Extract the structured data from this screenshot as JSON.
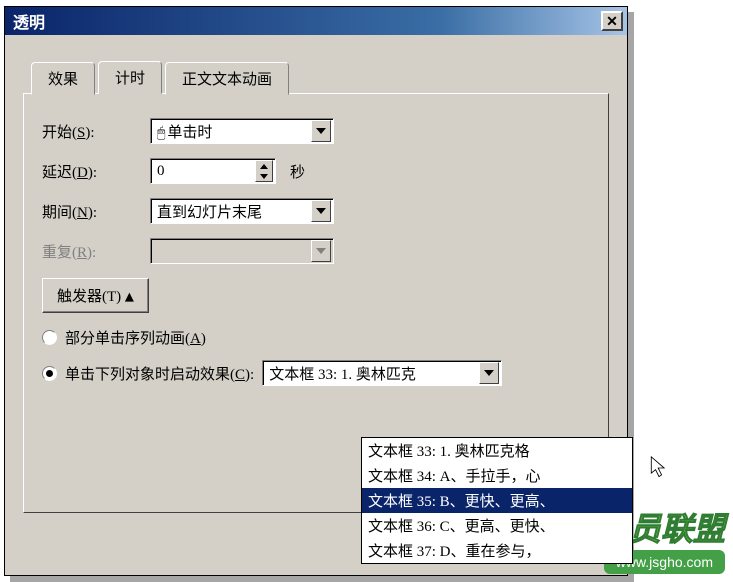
{
  "window": {
    "title": "透明"
  },
  "tabs": {
    "items": [
      {
        "label": "效果"
      },
      {
        "label": "计时"
      },
      {
        "label": "正文文本动画"
      }
    ],
    "selected": 1
  },
  "timing": {
    "start_label": "开始(S):",
    "start_value": "单击时",
    "delay_label": "延迟(D):",
    "delay_value": "0",
    "delay_unit": "秒",
    "duration_label": "期间(N):",
    "duration_value": "直到幻灯片末尾",
    "repeat_label": "重复(R):",
    "repeat_value": "",
    "triggers_btn": "触发器(T)",
    "collapse_symbol": "±"
  },
  "triggers": {
    "option_sequence": "部分单击序列动画(A)",
    "option_onclick": "单击下列对象时启动效果(C):",
    "selected": "onclick",
    "target_value": "文本框 33: 1. 奥林匹克",
    "dropdown_items": [
      "文本框 33: 1. 奥林匹克格",
      "文本框 34: A、手拉手，心",
      "文本框 35: B、更快、更高、",
      "文本框 36: C、更高、更快、",
      "文本框 37: D、重在参与，"
    ],
    "dropdown_selected": 2
  },
  "watermark": {
    "text": "技术员联盟",
    "url": "www.jsgho.com"
  }
}
